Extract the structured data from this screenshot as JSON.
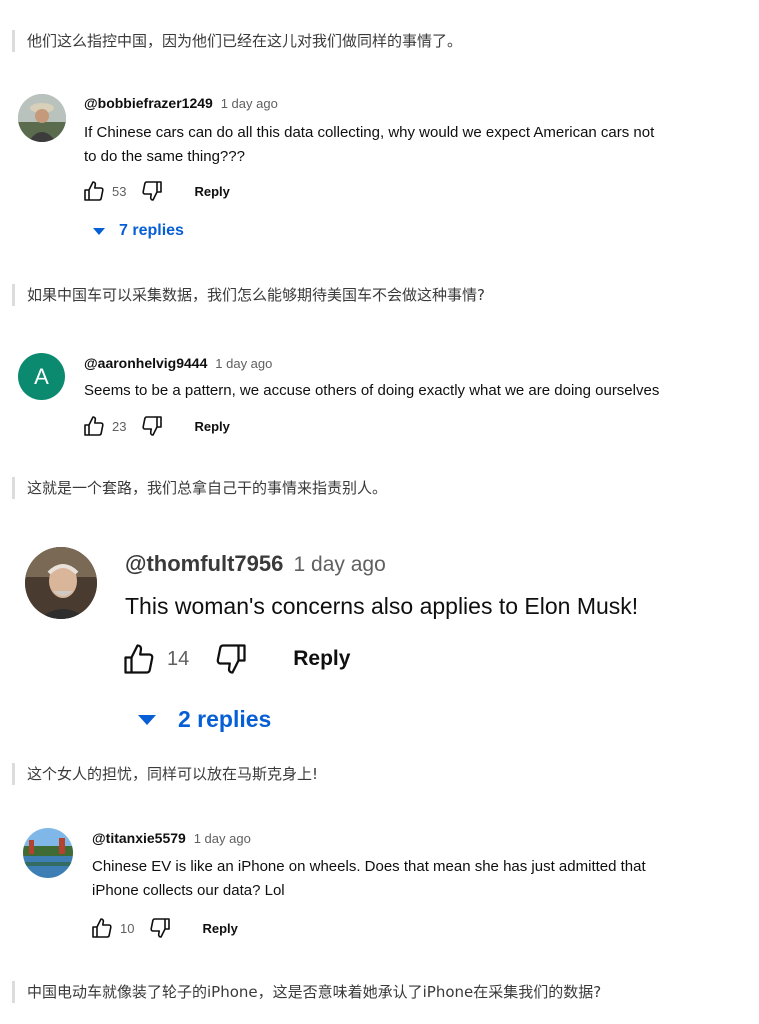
{
  "theme": {
    "link_color": "#065fd4",
    "quote_border": "#dcdcdc",
    "avatar_a_color": "#0b8a6f"
  },
  "quotes": [
    "他们这么指控中国，因为他们已经在这儿对我们做同样的事情了。",
    "如果中国车可以采集数据，我们怎么能够期待美国车不会做这种事情?",
    "这就是一个套路，我们总拿自己干的事情来指责别人。",
    "这个女人的担忧，同样可以放在马斯克身上!",
    "中国电动车就像装了轮子的iPhone，这是否意味着她承认了iPhone在采集我们的数据?"
  ],
  "comments": [
    {
      "handle": "@bobbiefrazer1249",
      "time": "1 day ago",
      "text_lines": [
        "If Chinese cars can do all this data collecting, why would we expect American cars not",
        "to do the same thing???"
      ],
      "likes": "53",
      "reply_label": "Reply",
      "replies_label": "7 replies",
      "avatar_icon": "user-photo"
    },
    {
      "handle": "@aaronhelvig9444",
      "time": "1 day ago",
      "text_lines": [
        "Seems to be a pattern, we accuse others of doing exactly what we are doing ourselves"
      ],
      "likes": "23",
      "reply_label": "Reply",
      "avatar_letter": "A"
    },
    {
      "handle": "@thomfult7956",
      "time": "1 day ago",
      "text_lines": [
        "This woman's concerns also applies to Elon Musk!"
      ],
      "likes": "14",
      "reply_label": "Reply",
      "replies_label": "2 replies",
      "avatar_icon": "user-photo"
    },
    {
      "handle": "@titanxie5579",
      "time": "1 day ago",
      "text_lines": [
        "Chinese EV is like an iPhone on wheels. Does that mean she has just admitted that",
        "iPhone collects our data? Lol"
      ],
      "likes": "10",
      "reply_label": "Reply",
      "avatar_icon": "landscape-photo"
    }
  ]
}
